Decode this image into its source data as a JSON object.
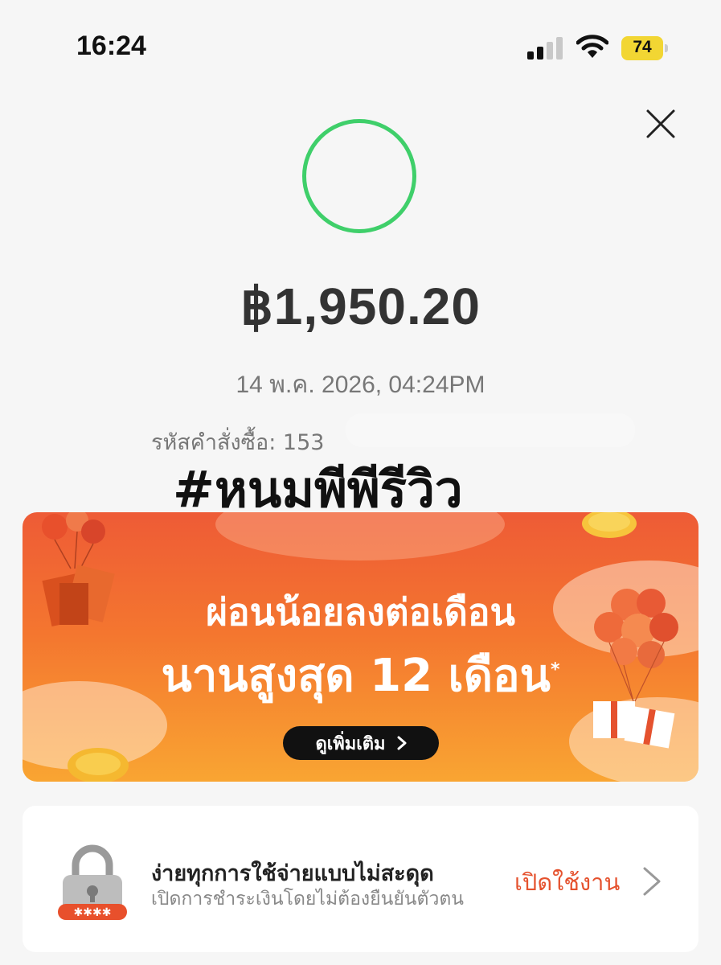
{
  "status_bar": {
    "time": "16:24",
    "battery": "74"
  },
  "receipt": {
    "amount": "฿1,950.20",
    "datetime": "14 พ.ค. 2026, 04:24PM",
    "order_label": "รหัสคำสั่งซื้อ: 153"
  },
  "overlay": {
    "hashtag": "#หนมพีพีรีวิว"
  },
  "banner": {
    "line1": "ผ่อนน้อยลงต่อเดือน",
    "line2": "นานสูงสุด 12 เดือน",
    "line2_mark": "*",
    "button_label": "ดูเพิ่มเติม"
  },
  "promo_card": {
    "title": "ง่ายทุกการใช้จ่ายแบบไม่สะดุด",
    "subtitle": "เปิดการชำระเงินโดยไม่ต้องยืนยันตัวตน",
    "action": "เปิดใช้งาน"
  },
  "icons": [
    "signal-icon",
    "wifi-icon",
    "battery-icon",
    "close-icon",
    "success-circle-icon",
    "lock-icon",
    "chevron-right-icon"
  ],
  "colors": {
    "success": "#3fcf6a",
    "accent": "#e5522e",
    "battery": "#f2d633"
  }
}
